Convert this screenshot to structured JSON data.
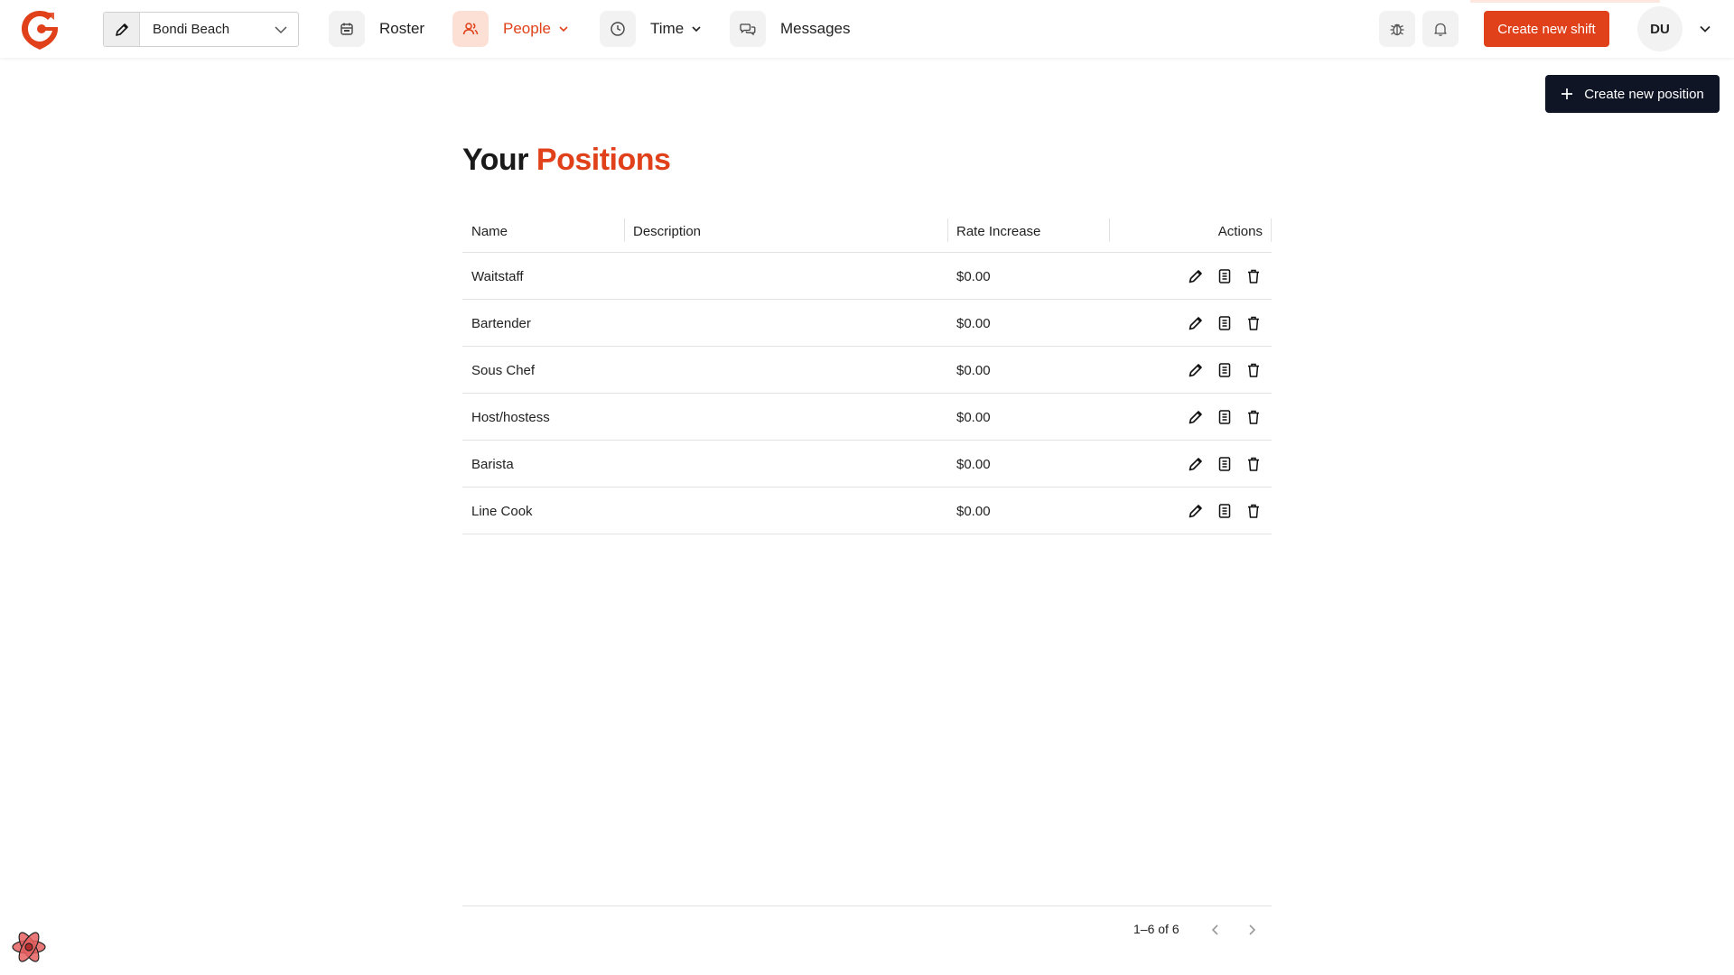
{
  "header": {
    "location": "Bondi Beach",
    "nav": [
      {
        "label": "Roster",
        "icon": "calendar-icon"
      },
      {
        "label": "People",
        "icon": "people-icon",
        "active": true
      },
      {
        "label": "Time",
        "icon": "clock-icon"
      },
      {
        "label": "Messages",
        "icon": "chat-icon"
      }
    ],
    "create_shift_label": "Create new shift",
    "avatar_initials": "DU"
  },
  "toolbar": {
    "create_position_label": "Create new position"
  },
  "page": {
    "title_part1": "Your",
    "title_part2": "Positions"
  },
  "table": {
    "columns": [
      "Name",
      "Description",
      "Rate Increase",
      "Actions"
    ],
    "rows": [
      {
        "name": "Waitstaff",
        "description": "",
        "rate": "$0.00"
      },
      {
        "name": "Bartender",
        "description": "",
        "rate": "$0.00"
      },
      {
        "name": "Sous Chef",
        "description": "",
        "rate": "$0.00"
      },
      {
        "name": "Host/hostess",
        "description": "",
        "rate": "$0.00"
      },
      {
        "name": "Barista",
        "description": "",
        "rate": "$0.00"
      },
      {
        "name": "Line Cook",
        "description": "",
        "rate": "$0.00"
      }
    ]
  },
  "pagination": {
    "range_text": "1–6 of 6"
  },
  "colors": {
    "accent": "#e0411a",
    "dark": "#0f1524",
    "active_bg": "#fde0d5"
  }
}
